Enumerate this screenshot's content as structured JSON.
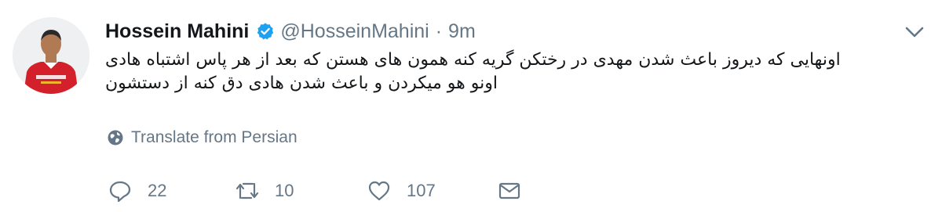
{
  "tweet": {
    "author_name": "Hossein Mahini",
    "author_handle": "@HosseinMahini",
    "separator": "·",
    "time": "9m",
    "text_lines": [
      "اونهایی که دیروز باعث شدن مهدی در رختکن گریه کنه همون های هستن که بعد از هر پاس اشتباه هادی",
      "اونو هو میکردن و باعث شدن  هادی دق کنه از دستشون"
    ],
    "translate_label": "Translate from Persian",
    "counts": {
      "replies": "22",
      "retweets": "10",
      "likes": "107"
    }
  },
  "icons": {
    "verified": "verified-badge-icon",
    "caret": "chevron-down-icon",
    "translate": "globe-icon",
    "reply": "reply-icon",
    "retweet": "retweet-icon",
    "like": "heart-icon",
    "dm": "envelope-icon"
  },
  "colors": {
    "verified": "#1da1f2",
    "text": "#14171a",
    "muted": "#657786",
    "jersey": "#d3202a"
  }
}
